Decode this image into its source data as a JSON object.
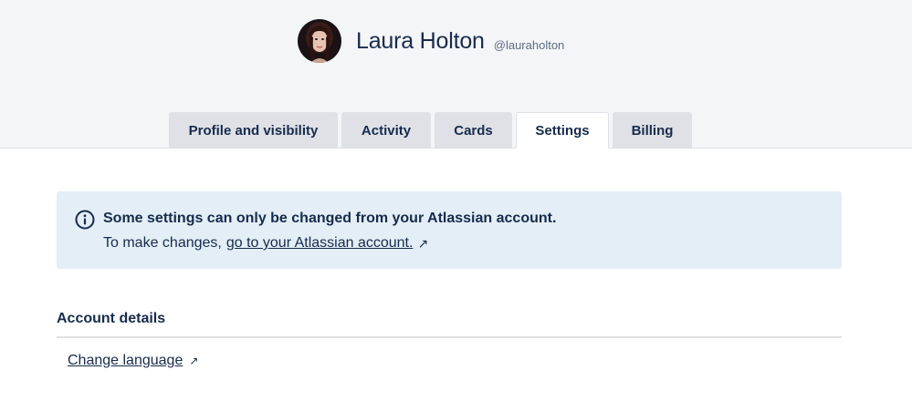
{
  "profile": {
    "full_name": "Laura Holton",
    "username": "@lauraholton"
  },
  "tabs": [
    {
      "label": "Profile and visibility",
      "active": false
    },
    {
      "label": "Activity",
      "active": false
    },
    {
      "label": "Cards",
      "active": false
    },
    {
      "label": "Settings",
      "active": true
    },
    {
      "label": "Billing",
      "active": false
    }
  ],
  "notice": {
    "title": "Some settings can only be changed from your Atlassian account.",
    "body_prefix": "To make changes,",
    "link_text": "go to your Atlassian account.",
    "icon": "info-icon",
    "external_icon": "↗"
  },
  "account_details": {
    "title": "Account details",
    "change_language_label": "Change language",
    "external_icon": "↗"
  },
  "colors": {
    "header_bg": "#f4f5f7",
    "text": "#172b4d",
    "notice_bg": "#e3eef6",
    "tab_bg": "#dfe1e6"
  }
}
